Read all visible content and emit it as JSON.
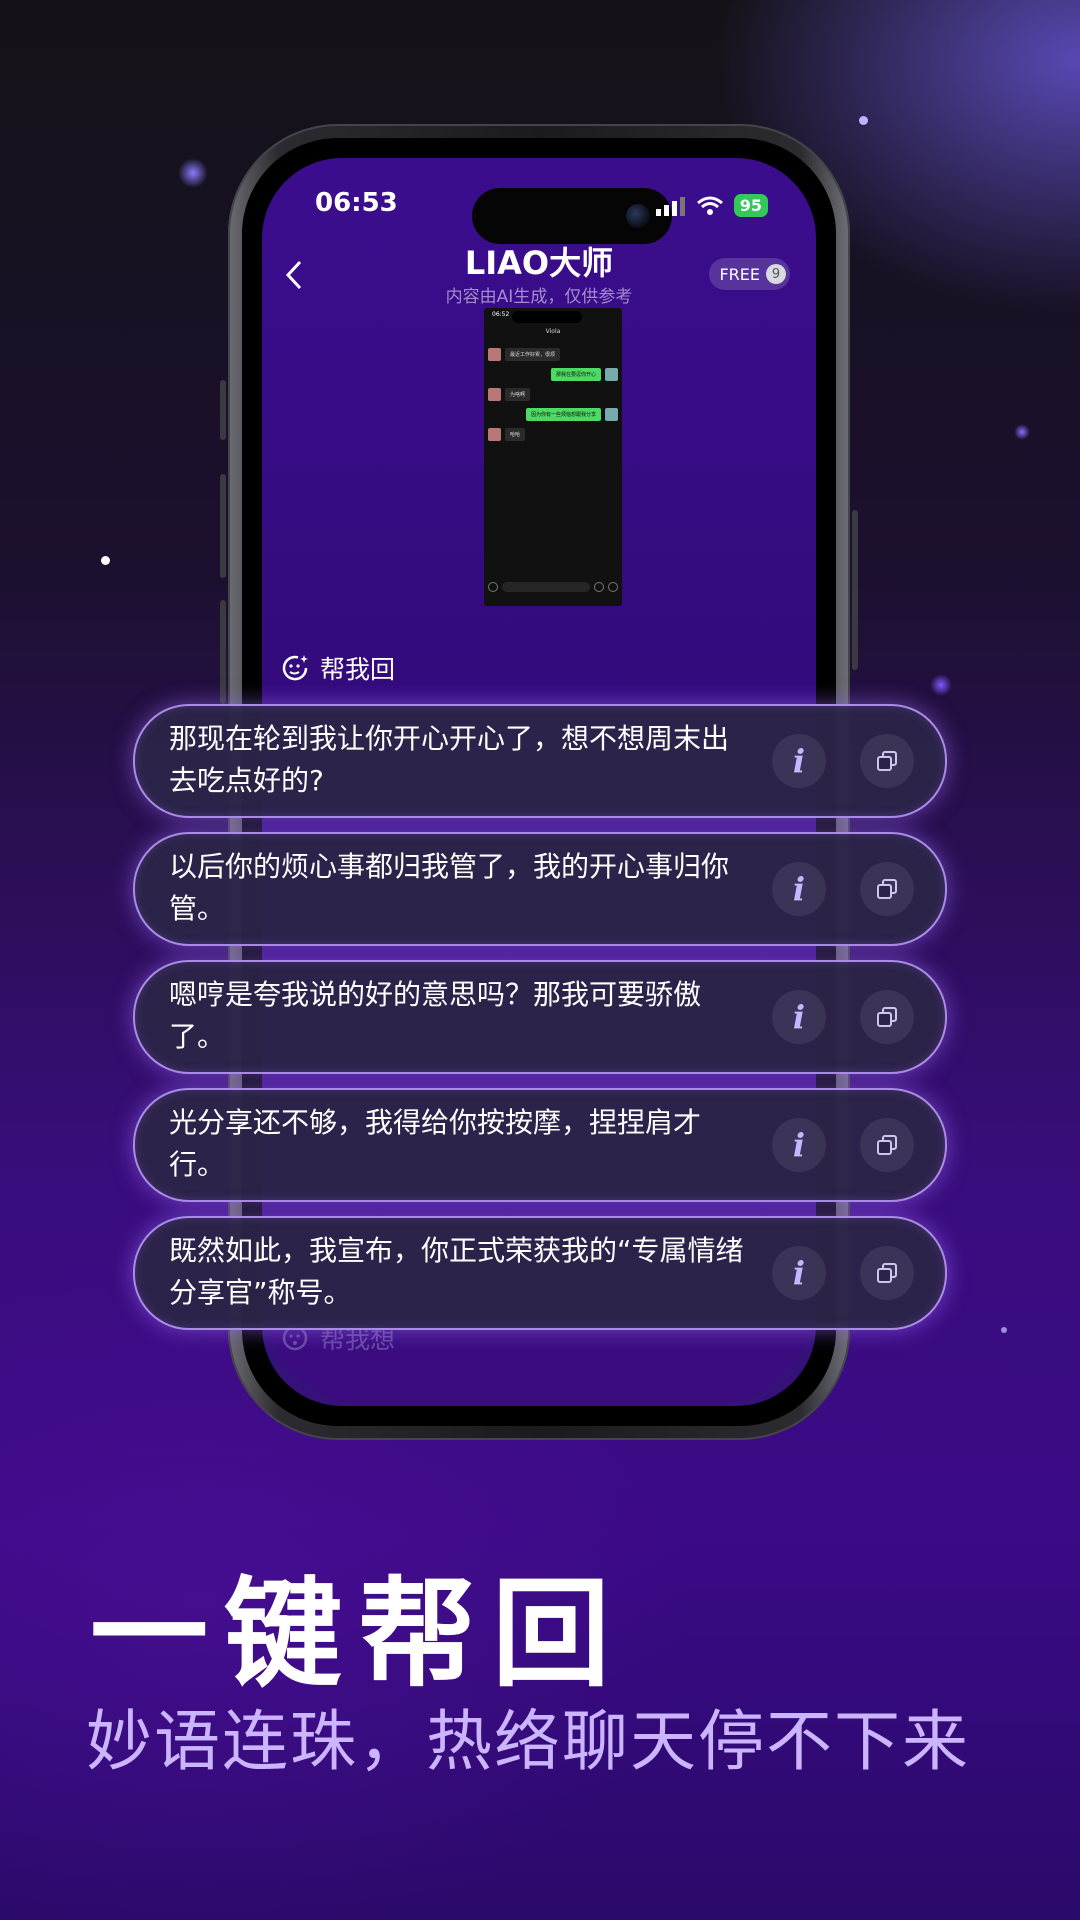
{
  "phone": {
    "time": "06:53",
    "battery": "95",
    "title": "LIAO大师",
    "subtitle": "内容由AI生成，仅供参考",
    "free_label": "FREE",
    "free_count": "9",
    "help_reply_label": "帮我回",
    "help_think_label": "帮我想"
  },
  "mini_chat": {
    "time": "06:52",
    "name": "Viola",
    "messages": [
      "最近工作好累，很烦",
      "那我在要逗你开心",
      "为啥啊",
      "因为你有一些烦恼想跟我分享",
      "哈哈"
    ]
  },
  "suggestions": [
    {
      "text": "那现在轮到我让你开心开心了，想不想周末出去吃点好的?"
    },
    {
      "text": "以后你的烦心事都归我管了，我的开心事归你管。"
    },
    {
      "text": "嗯哼是夸我说的好的意思吗？那我可要骄傲了。"
    },
    {
      "text": "光分享还不够，我得给你按按摩，捏捏肩才行。"
    },
    {
      "text": "既然如此，我宣布，你正式荣获我的“专属情绪分享官”称号。"
    }
  ],
  "info_label": "i",
  "headline": "一键帮回",
  "tagline": "妙语连珠，热络聊天停不下来",
  "colors": {
    "accent": "#a98ce6",
    "battery": "#34c759",
    "background": "#3b0a86"
  }
}
